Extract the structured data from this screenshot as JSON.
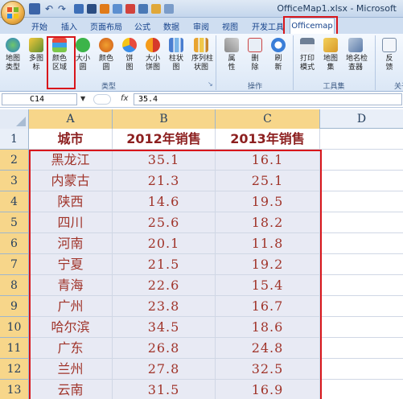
{
  "window": {
    "title": "OfficeMap1.xlsx - Microsoft"
  },
  "ribbon_tabs": [
    "开始",
    "插入",
    "页面布局",
    "公式",
    "数据",
    "审阅",
    "视图",
    "开发工具",
    "Officemap"
  ],
  "active_tab": "Officemap",
  "ribbon": {
    "groups": [
      {
        "label": "类型",
        "buttons": [
          {
            "label": "地图\n类型",
            "icon": "globe-icon"
          },
          {
            "label": "多图\n标",
            "icon": "multi-marker-icon"
          },
          {
            "label": "颜色\n区域",
            "icon": "color-region-icon"
          },
          {
            "label": "大小\n圆",
            "icon": "size-circle-icon"
          },
          {
            "label": "颜色\n圆",
            "icon": "color-circle-icon"
          },
          {
            "label": "饼\n图",
            "icon": "pie-chart-icon"
          },
          {
            "label": "大小\n饼图",
            "icon": "size-pie-icon"
          },
          {
            "label": "柱状\n图",
            "icon": "bar-chart-icon"
          },
          {
            "label": "序列柱\n状图",
            "icon": "series-bar-icon"
          }
        ]
      },
      {
        "label": "操作",
        "buttons": [
          {
            "label": "属\n性",
            "icon": "tools-icon"
          },
          {
            "label": "删\n除",
            "icon": "delete-icon"
          },
          {
            "label": "刷\n新",
            "icon": "refresh-icon"
          }
        ]
      },
      {
        "label": "工具集",
        "buttons": [
          {
            "label": "打印\n模式",
            "icon": "print-icon"
          },
          {
            "label": "地图\n集",
            "icon": "map-set-icon"
          },
          {
            "label": "地名检\n查器",
            "icon": "place-check-icon"
          }
        ]
      },
      {
        "label": "关于",
        "buttons": [
          {
            "label": "反\n馈",
            "icon": "mail-icon"
          }
        ]
      }
    ]
  },
  "formula_bar": {
    "name_box": "C14",
    "fx_label": "fx",
    "formula": "35.4"
  },
  "sheet": {
    "columns": [
      "A",
      "B",
      "C",
      "D"
    ],
    "header_row": [
      "城市",
      "2012年销售",
      "2013年销售"
    ],
    "rows": [
      {
        "row": "2",
        "city": "黑龙江",
        "y2012": "35.1",
        "y2013": "16.1"
      },
      {
        "row": "3",
        "city": "内蒙古",
        "y2012": "21.3",
        "y2013": "25.1"
      },
      {
        "row": "4",
        "city": "陕西",
        "y2012": "14.6",
        "y2013": "19.5"
      },
      {
        "row": "5",
        "city": "四川",
        "y2012": "25.6",
        "y2013": "18.2"
      },
      {
        "row": "6",
        "city": "河南",
        "y2012": "20.1",
        "y2013": "11.8"
      },
      {
        "row": "7",
        "city": "宁夏",
        "y2012": "21.5",
        "y2013": "19.2"
      },
      {
        "row": "8",
        "city": "青海",
        "y2012": "22.6",
        "y2013": "15.4"
      },
      {
        "row": "9",
        "city": "广州",
        "y2012": "23.8",
        "y2013": "16.7"
      },
      {
        "row": "10",
        "city": "哈尔滨",
        "y2012": "34.5",
        "y2013": "18.6"
      },
      {
        "row": "11",
        "city": "广东",
        "y2012": "26.8",
        "y2013": "24.8"
      },
      {
        "row": "12",
        "city": "兰州",
        "y2012": "27.8",
        "y2013": "32.5"
      },
      {
        "row": "13",
        "city": "云南",
        "y2012": "31.5",
        "y2013": "16.9"
      }
    ],
    "header_row_number": "1"
  },
  "colors": {
    "highlight": "#d8161b",
    "selected_header": "#f7d68a",
    "text_red": "#a0342a"
  }
}
